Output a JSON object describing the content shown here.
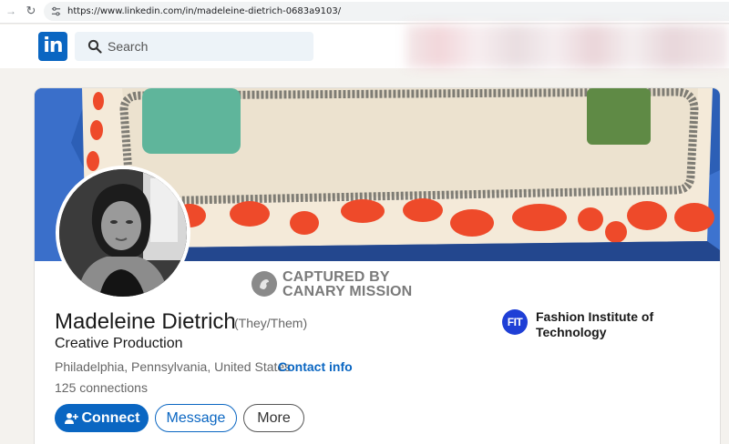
{
  "browser": {
    "url": "https://www.linkedin.com/in/madeleine-dietrich-0683a9103/"
  },
  "header": {
    "logo_text": "in",
    "search_placeholder": "Search"
  },
  "watermark": {
    "line1": "CAPTURED BY",
    "line2": "CANARY MISSION"
  },
  "profile": {
    "name": "Madeleine Dietrich",
    "pronouns": "(They/Them)",
    "headline": "Creative Production",
    "location": "Philadelphia, Pennsylvania, United States ·",
    "contact_info": "Contact info",
    "connections": "125 connections"
  },
  "actions": {
    "connect_label": "Connect",
    "message_label": "Message",
    "more_label": "More"
  },
  "education": {
    "logo_text": "FIT",
    "school": "Fashion Institute of Technology"
  },
  "colors": {
    "linkedin_blue": "#0a66c2",
    "fit_blue": "#1f3fd6",
    "page_bg": "#f4f2ee"
  },
  "icons": {
    "back": "arrow-right-icon",
    "reload": "reload-icon",
    "site_info": "tune-icon",
    "search": "search-icon",
    "connect": "add-person-icon",
    "watermark": "canary-bird-icon"
  }
}
